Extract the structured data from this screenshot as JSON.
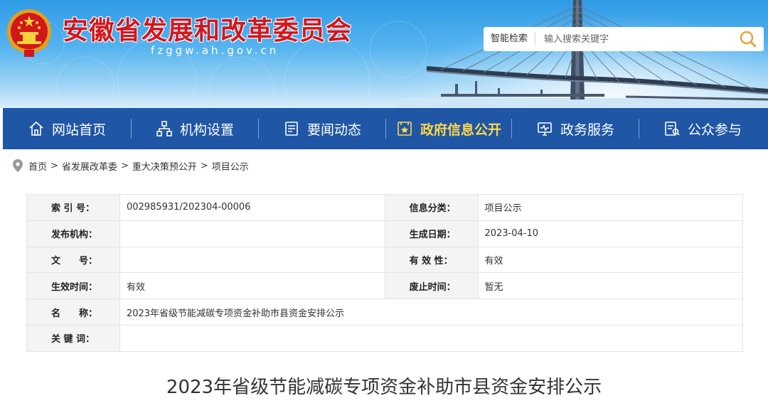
{
  "header": {
    "title": "安徽省发展和改革委员会",
    "domain": "fzggw.ah.gov.cn",
    "search": {
      "label": "智能检索",
      "placeholder": "输入搜索关键字"
    }
  },
  "nav": {
    "items": [
      {
        "label": "网站首页",
        "icon": "home-icon"
      },
      {
        "label": "机构设置",
        "icon": "org-chart-icon"
      },
      {
        "label": "要闻动态",
        "icon": "news-icon"
      },
      {
        "label": "政府信息公开",
        "icon": "info-disclosure-icon",
        "active": true
      },
      {
        "label": "政务服务",
        "icon": "service-monitor-icon"
      },
      {
        "label": "公众参与",
        "icon": "participation-icon"
      }
    ],
    "active_color": "#ffd84a",
    "bar_color": "#1f56a6"
  },
  "breadcrumb": [
    "首页",
    "省发展改革委",
    "重大决策预公开",
    "项目公示"
  ],
  "info": {
    "rows": [
      {
        "k1": "索 引 号：",
        "v1": "002985931/202304-00006",
        "k2": "信息分类：",
        "v2": "项目公示"
      },
      {
        "k1": "发布机构：",
        "v1": "",
        "k2": "生成日期：",
        "v2": "2023-04-10"
      },
      {
        "k1": "文　　号：",
        "v1": "",
        "k2": "有 效 性：",
        "v2": "有效"
      },
      {
        "k1": "生效时间：",
        "v1": "有效",
        "k2": "废止时间：",
        "v2": "暂无"
      },
      {
        "k1": "名　　称：",
        "v1": "2023年省级节能减碳专项资金补助市县资金安排公示"
      },
      {
        "k1": "关 键 词：",
        "v1": ""
      }
    ]
  },
  "article": {
    "title": "2023年省级节能减碳专项资金补助市县资金安排公示"
  },
  "colors": {
    "title_red": "#d4161c",
    "header_blue": "#2f9be6"
  }
}
